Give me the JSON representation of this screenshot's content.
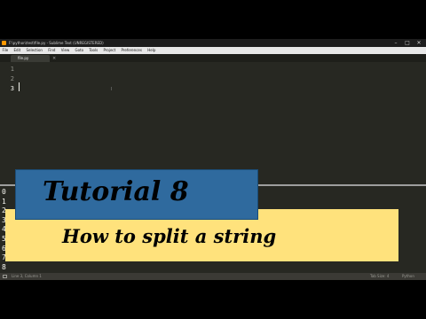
{
  "window": {
    "title": "F:\\python\\test\\file.py - Sublime Text (UNREGISTERED)",
    "controls": {
      "minimize": "–",
      "maximize": "□",
      "close": "✕"
    }
  },
  "menu": [
    "File",
    "Edit",
    "Selection",
    "Find",
    "View",
    "Goto",
    "Tools",
    "Project",
    "Preferences",
    "Help"
  ],
  "tab": {
    "label": "file.py",
    "close": "×"
  },
  "tab_nav": {
    "left": "◂",
    "right": "▾"
  },
  "editor": {
    "line_numbers": [
      "1",
      "2",
      "3"
    ],
    "current_line": "3"
  },
  "console": {
    "lines": [
      "0",
      "1",
      "2",
      "3",
      "4",
      "5",
      "6",
      "7",
      "8"
    ]
  },
  "statusbar": {
    "position": "Line 3, Column 1",
    "tab_size": "Tab Size: 4",
    "syntax": "Python"
  },
  "overlay": {
    "title": "Tutorial 8",
    "subtitle": "How to split a string"
  },
  "colors": {
    "overlay_blue": "#2f6a9e",
    "overlay_yellow": "#ffe27c",
    "editor_bg": "#272822"
  }
}
